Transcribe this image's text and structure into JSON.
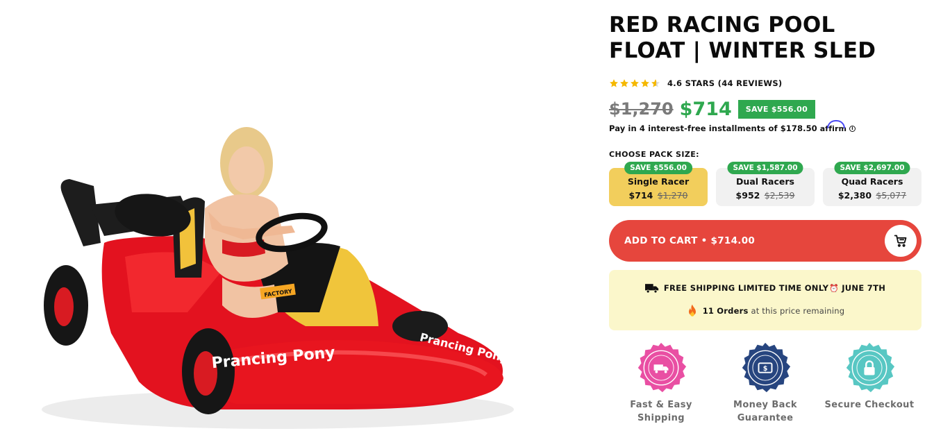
{
  "product": {
    "title_line1": "RED RACING POOL",
    "title_line2": "FLOAT | WINTER SLED",
    "rating_text": "4.6 STARS (44 REVIEWS)",
    "rating_value": 4.6,
    "old_price": "$1,270",
    "new_price": "$714",
    "save_badge": "SAVE $556.00",
    "installments_text": "Pay in 4 interest-free installments of $178.50",
    "affirm_label": "affirm",
    "info_icon": "i"
  },
  "image": {
    "float_text_front": "Prancing Pony",
    "float_text_side": "Prancing Pony",
    "sticker_text": "FACTORY"
  },
  "pack": {
    "label": "CHOOSE PACK SIZE:",
    "options": [
      {
        "save": "SAVE $556.00",
        "name": "Single Racer",
        "price": "$714",
        "old_price": "$1,270",
        "selected": true
      },
      {
        "save": "SAVE $1,587.00",
        "name": "Dual Racers",
        "price": "$952",
        "old_price": "$2,539",
        "selected": false
      },
      {
        "save": "SAVE $2,697.00",
        "name": "Quad Racers",
        "price": "$2,380",
        "old_price": "$5,077",
        "selected": false
      }
    ]
  },
  "cart": {
    "label": "ADD TO CART • $714.00",
    "icon": "cart-icon"
  },
  "shipping": {
    "text": "FREE SHIPPING LIMITED TIME ONLY",
    "date": "JUNE 7TH",
    "clock": "⏰",
    "orders_count": "11 Orders",
    "orders_text": "at this price remaining"
  },
  "badges": [
    {
      "line1": "Fast & Easy",
      "line2": "Shipping",
      "ring_text": "FAST & EASY · SHIPPING",
      "color": "#e94fa3"
    },
    {
      "line1": "Money Back",
      "line2": "Guarantee",
      "ring_text": "MONEY BACK · GUARANTEE",
      "color": "#27457f"
    },
    {
      "line1": "Secure Checkout",
      "line2": "",
      "ring_text": "SECURE · CHECKOUT",
      "color": "#58c7c3"
    }
  ],
  "colors": {
    "green": "#2fa84f",
    "red": "#e6463d",
    "yellow": "#f2ce5c",
    "star": "#f5b800"
  }
}
